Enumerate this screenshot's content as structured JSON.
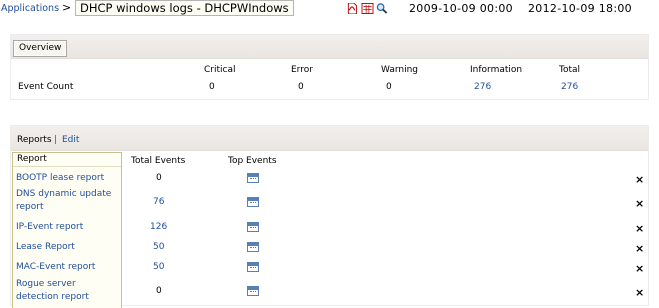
{
  "header": {
    "breadcrumb": "Applications",
    "separator": ">",
    "title": "DHCP windows logs - DHCPWIndows",
    "icons": [
      "pdf-export-icon",
      "csv-export-icon",
      "search-icon"
    ],
    "date_start": "2009-10-09 00:00",
    "date_end": "2012-10-09 18:00"
  },
  "overview": {
    "tab_label": "Overview",
    "columns": [
      "Critical",
      "Error",
      "Warning",
      "Information",
      "Total"
    ],
    "row_label": "Event Count",
    "values": [
      "0",
      "0",
      "0",
      "276",
      "276"
    ]
  },
  "reports": {
    "tab_label": "Reports",
    "separator": "|",
    "edit_label": "Edit",
    "list_header": "Report",
    "col_total": "Total Events",
    "col_top": "Top Events",
    "close_glyph": "×",
    "rows": [
      {
        "name": "BOOTP lease report",
        "total": "0"
      },
      {
        "name": "DNS dynamic update report",
        "total": "76"
      },
      {
        "name": "IP-Event report",
        "total": "126"
      },
      {
        "name": "Lease Report",
        "total": "50"
      },
      {
        "name": "MAC-Event report",
        "total": "50"
      },
      {
        "name": "Rogue server detection report",
        "total": "0"
      }
    ]
  },
  "colors": {
    "link": "#1f4e9b",
    "panel_bar": "#ece9e5",
    "report_list_bg": "#fffef4"
  }
}
